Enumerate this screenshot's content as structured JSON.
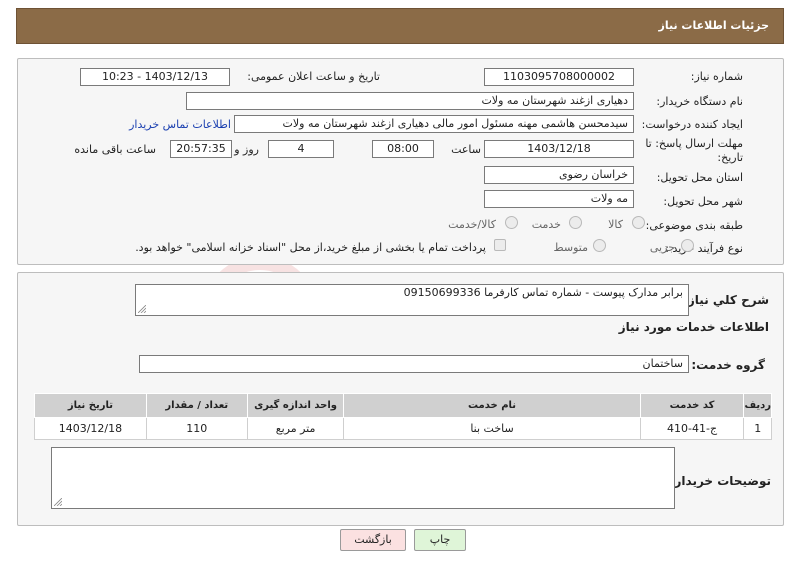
{
  "header": {
    "title": "جزئیات اطلاعات نیاز"
  },
  "fields": {
    "need_number_label": "شماره نیاز:",
    "need_number": "1103095708000002",
    "announce_label": "تاریخ و ساعت اعلان عمومی:",
    "announce_value": "1403/12/13 - 10:23",
    "buyer_org_label": "نام دستگاه خریدار:",
    "buyer_org": "دهیاری ازغند  شهرستان مه ولات",
    "creator_label": "ایجاد کننده درخواست:",
    "creator": "سیدمحسن هاشمی مهنه مسئول امور مالی دهیاری ازغند  شهرستان مه ولات",
    "contact_link": "اطلاعات تماس خریدار",
    "deadline_label": "مهلت ارسال پاسخ: تا تاریخ:",
    "deadline_date": "1403/12/18",
    "time_label": "ساعت",
    "deadline_time": "08:00",
    "days_value": "4",
    "days_label": "روز و",
    "remaining_value": "20:57:35",
    "remaining_label": "ساعت باقی مانده",
    "province_label": "استان محل تحویل:",
    "province": "خراسان رضوی",
    "city_label": "شهر محل تحویل:",
    "city": "مه ولات",
    "category_label": "طبقه بندی موضوعی:",
    "category_options": [
      "کالا",
      "خدمت",
      "کالا/خدمت"
    ],
    "process_label": "نوع فرآیند خرید :",
    "process_options": [
      "جزیی",
      "متوسط"
    ],
    "payment_note": "پرداخت تمام یا بخشی از مبلغ خرید،از محل \"اسناد خزانه اسلامی\" خواهد بود."
  },
  "summary": {
    "label": "شرح کلي نياز:",
    "text": "برابر مدارک پیوست - شماره تماس کارفرما 09150699336"
  },
  "services": {
    "section_title": "اطلاعات خدمات مورد نياز",
    "group_label": "گروه خدمت:",
    "group_value": "ساختمان",
    "columns": [
      "رديف",
      "کد خدمت",
      "نام خدمت",
      "واحد اندازه گيری",
      "تعداد / مقدار",
      "تاريخ نياز"
    ],
    "rows": [
      [
        "1",
        "ج-41-410",
        "ساخت بنا",
        "متر مربع",
        "110",
        "1403/12/18"
      ]
    ]
  },
  "buyer_notes": {
    "label": "توضيحات خريدار:",
    "text": ""
  },
  "buttons": {
    "print": "چاپ",
    "back": "بازگشت"
  },
  "watermark": {
    "text": "AriaTender.neT"
  },
  "colors": {
    "titlebar": "#8b6b47",
    "print_button": "#dff5d8",
    "back_button": "#fbe1e1"
  }
}
